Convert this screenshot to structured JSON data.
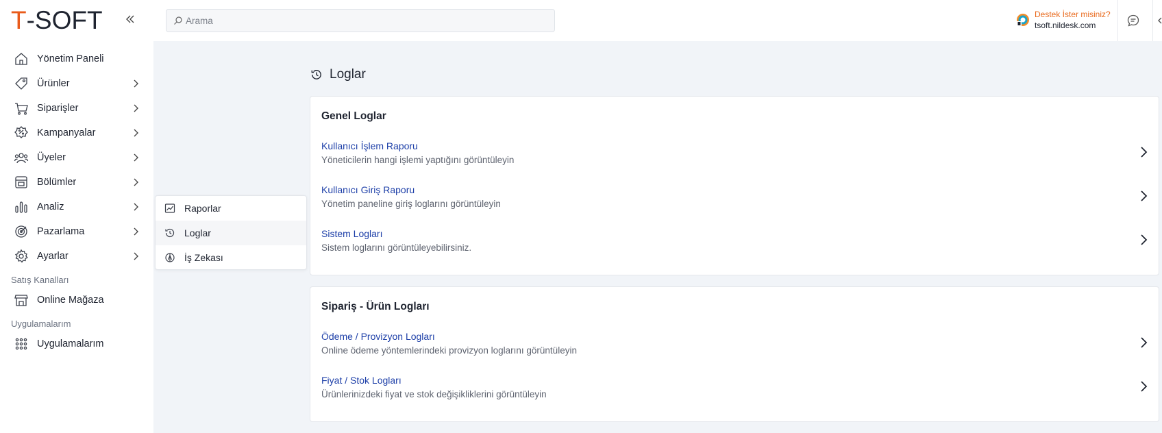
{
  "brand": {
    "logo_prefix": "T",
    "logo_rest": "-SOFT",
    "accent": "#e95b1b",
    "link": "#1d3fa8"
  },
  "search": {
    "placeholder": "Arama"
  },
  "support": {
    "question": "Destek İster misiniz?",
    "domain": "tsoft.nildesk.com"
  },
  "sidebar": {
    "items": [
      {
        "label": "Yönetim Paneli",
        "icon": "home-icon"
      },
      {
        "label": "Ürünler",
        "icon": "tag-icon"
      },
      {
        "label": "Siparişler",
        "icon": "cart-icon"
      },
      {
        "label": "Kampanyalar",
        "icon": "discount-icon"
      },
      {
        "label": "Üyeler",
        "icon": "users-icon"
      },
      {
        "label": "Bölümler",
        "icon": "sections-icon"
      },
      {
        "label": "Analiz",
        "icon": "analytics-icon"
      },
      {
        "label": "Pazarlama",
        "icon": "target-icon"
      },
      {
        "label": "Ayarlar",
        "icon": "gear-icon"
      }
    ],
    "sales_channels_title": "Satış Kanalları",
    "online_store": "Online Mağaza",
    "apps_title": "Uygulamalarım",
    "apps_item": "Uygulamalarım"
  },
  "flyout": {
    "items": [
      {
        "label": "Raporlar",
        "icon": "report-chart-icon"
      },
      {
        "label": "Loglar",
        "icon": "history-icon"
      },
      {
        "label": "İş Zekası",
        "icon": "compass-icon"
      }
    ]
  },
  "page": {
    "title": "Loglar"
  },
  "cards": [
    {
      "title": "Genel Loglar",
      "rows": [
        {
          "title": "Kullanıcı İşlem Raporu",
          "subtitle": "Yöneticilerin hangi işlemi yaptığını görüntüleyin"
        },
        {
          "title": "Kullanıcı Giriş Raporu",
          "subtitle": "Yönetim paneline giriş loglarını görüntüleyin"
        },
        {
          "title": "Sistem Logları",
          "subtitle": "Sistem loglarını görüntüleyebilirsiniz."
        }
      ]
    },
    {
      "title": "Sipariş - Ürün Logları",
      "rows": [
        {
          "title": "Ödeme / Provizyon Logları",
          "subtitle": "Online ödeme yöntemlerindeki provizyon loglarını görüntüleyin"
        },
        {
          "title": "Fiyat / Stok Logları",
          "subtitle": "Ürünlerinizdeki fiyat ve stok değişikliklerini görüntüleyin"
        }
      ]
    }
  ]
}
